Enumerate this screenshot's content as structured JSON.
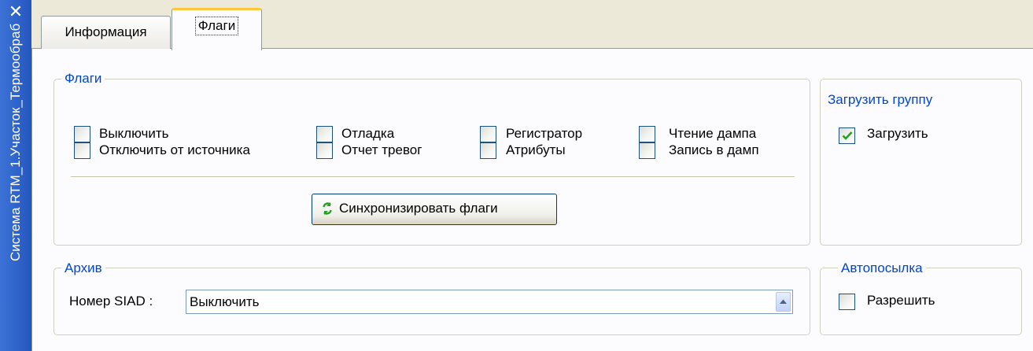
{
  "sidebar": {
    "title": "Система RTM_1.Участок_Термообраб",
    "close_glyph": "✕"
  },
  "tabs": [
    {
      "label": "Информация",
      "active": false
    },
    {
      "label": "Флаги",
      "active": true
    }
  ],
  "flags_group": {
    "legend": "Флаги",
    "checkboxes": [
      {
        "label": "Выключить",
        "checked": false
      },
      {
        "label": "Отладка",
        "checked": false
      },
      {
        "label": "Регистратор",
        "checked": false
      },
      {
        "label": "Чтение дампа",
        "checked": false
      },
      {
        "label": "Отключить от источника",
        "checked": false
      },
      {
        "label": "Отчет тревог",
        "checked": false
      },
      {
        "label": "Атрибуты",
        "checked": false
      },
      {
        "label": "Запись в дамп",
        "checked": false
      }
    ],
    "sync_button_label": "Синхронизировать флаги",
    "sync_icon": "refresh-icon"
  },
  "load_group": {
    "legend": "Загрузить группу",
    "checkbox": {
      "label": "Загрузить",
      "checked": true
    }
  },
  "archive_group": {
    "legend": "Архив",
    "field_label": "Номер SIAD :",
    "field_value": "Выключить"
  },
  "autosend_group": {
    "legend": "Автопосылка",
    "checkbox": {
      "label": "Разрешить",
      "checked": false
    }
  },
  "colors": {
    "accent": "#0046d5",
    "sidebar": "#2d62c9",
    "check_mark": "#21a121",
    "active_tab_highlight": "#ffc83c"
  }
}
